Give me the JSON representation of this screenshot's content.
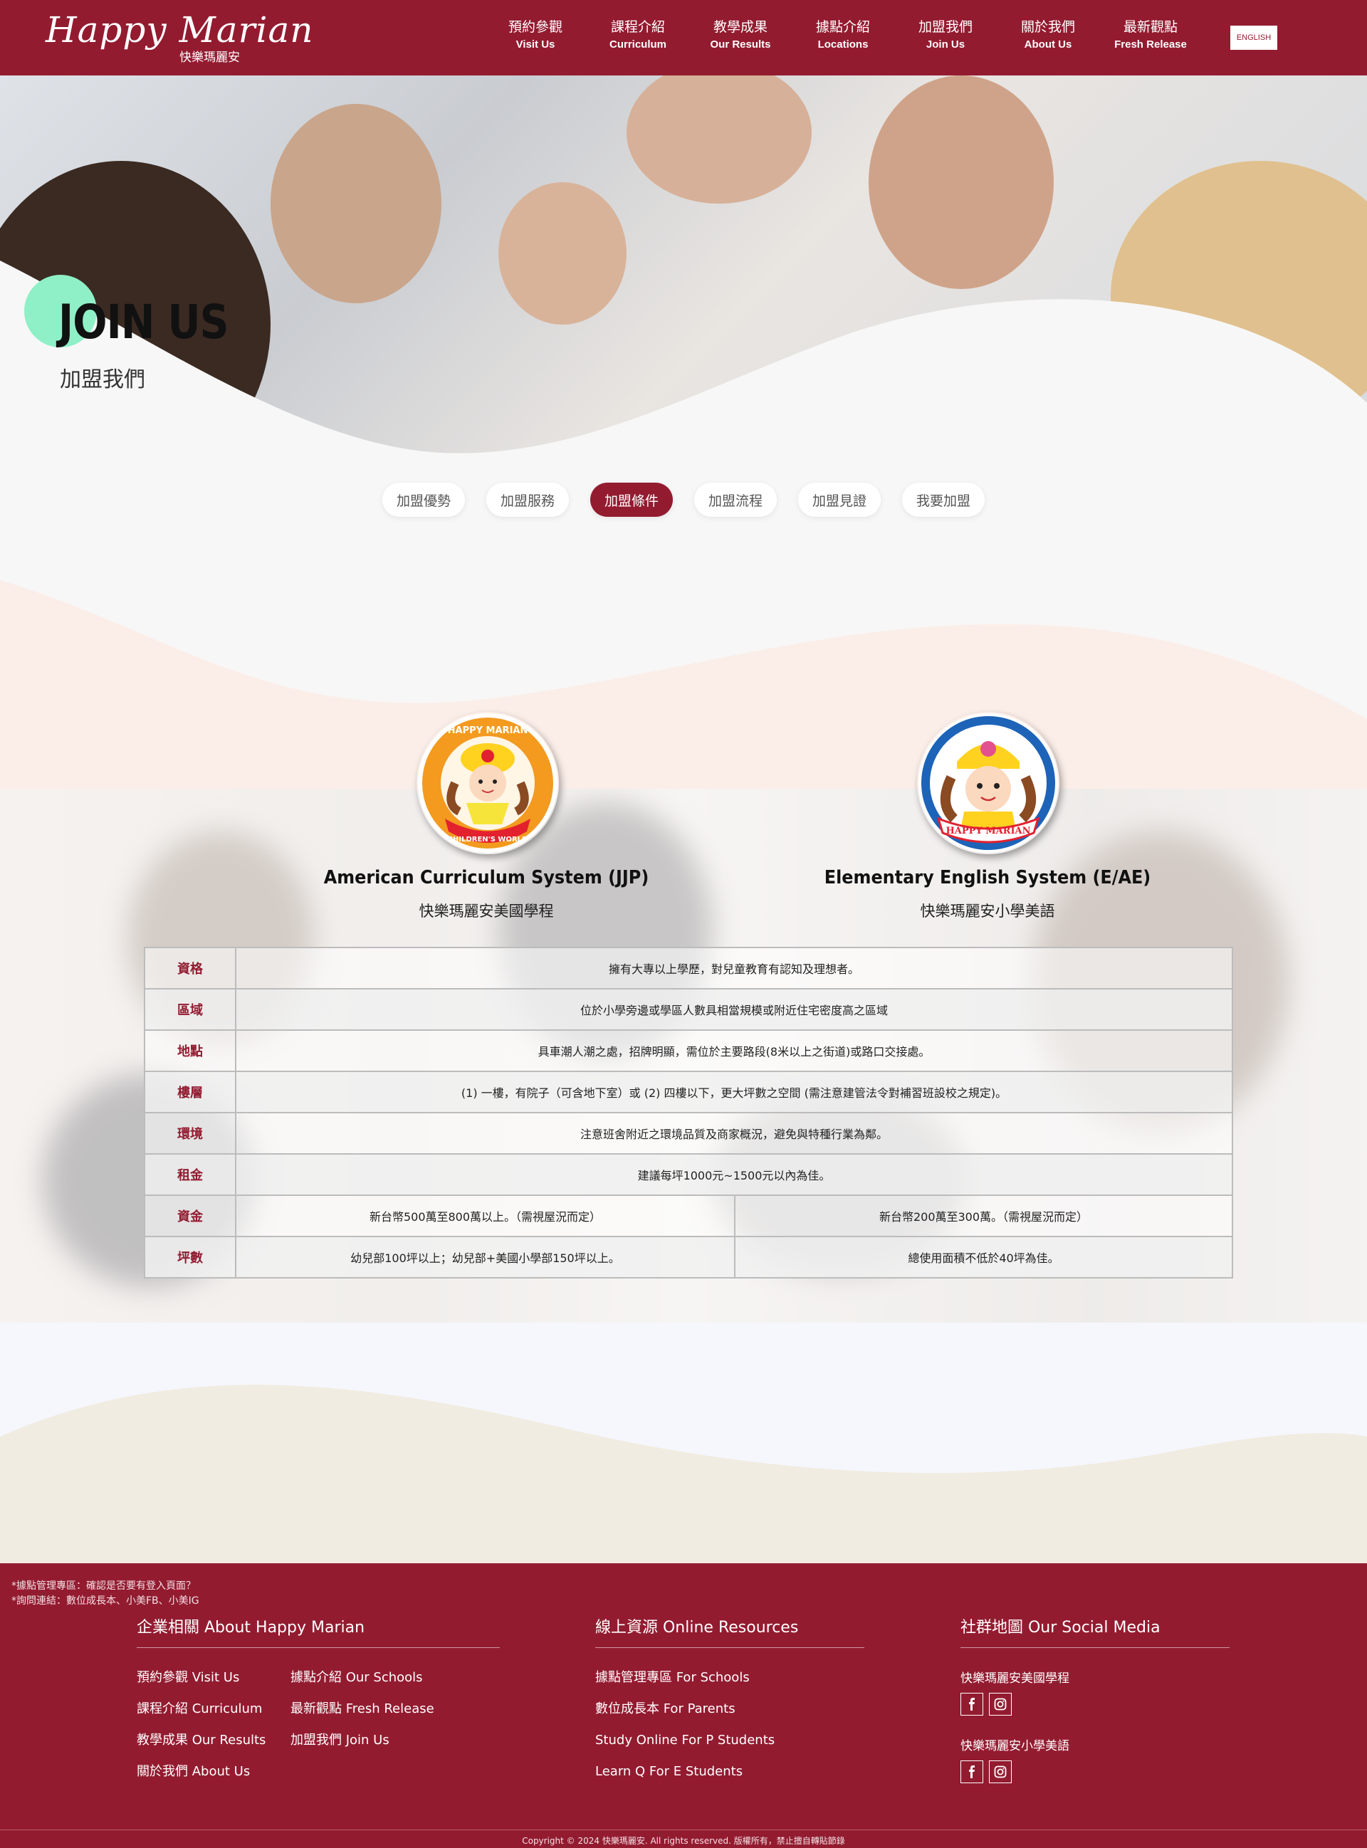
{
  "header": {
    "logo_main": "Happy Marian",
    "logo_sub": "快樂瑪麗安",
    "nav": [
      {
        "zh": "預約參觀",
        "en": "Visit Us"
      },
      {
        "zh": "課程介紹",
        "en": "Curriculum"
      },
      {
        "zh": "教學成果",
        "en": "Our Results"
      },
      {
        "zh": "據點介紹",
        "en": "Locations"
      },
      {
        "zh": "加盟我們",
        "en": "Join Us"
      },
      {
        "zh": "關於我們",
        "en": "About Us"
      },
      {
        "zh": "最新觀點",
        "en": "Fresh Release"
      }
    ],
    "lang_button": "ENGLISH"
  },
  "hero": {
    "title": "JOIN US",
    "subtitle": "加盟我們"
  },
  "tabs": [
    {
      "label": "加盟優勢",
      "active": false
    },
    {
      "label": "加盟服務",
      "active": false
    },
    {
      "label": "加盟條件",
      "active": true
    },
    {
      "label": "加盟流程",
      "active": false
    },
    {
      "label": "加盟見證",
      "active": false
    },
    {
      "label": "我要加盟",
      "active": false
    }
  ],
  "systems": [
    {
      "en": "American Curriculum System (JJP)",
      "zh": "快樂瑪麗安美國學程",
      "badge_top": "HAPPY MARIAN",
      "badge_bottom": "CHILDREN'S WORLD"
    },
    {
      "en": "Elementary English System (E/AE)",
      "zh": "快樂瑪麗安小學美語",
      "badge_ribbon": "HAPPY MARIAN"
    }
  ],
  "conditions": {
    "rows": [
      {
        "label": "資格",
        "value": "擁有大專以上學歷，對兒童教育有認知及理想者。"
      },
      {
        "label": "區域",
        "value": "位於小學旁邊或學區人數具相當規模或附近住宅密度高之區域"
      },
      {
        "label": "地點",
        "value": "具車潮人潮之處，招牌明顯，需位於主要路段(8米以上之街道)或路口交接處。"
      },
      {
        "label": "樓層",
        "value": "(1) 一樓，有院子（可含地下室）或 (2) 四樓以下，更大坪數之空間 (需注意建管法令對補習班設校之規定)。"
      },
      {
        "label": "環境",
        "value": "注意班舍附近之環境品質及商家概況，避免與特種行業為鄰。"
      },
      {
        "label": "租金",
        "value": "建議每坪1000元~1500元以內為佳。"
      }
    ],
    "split_rows": [
      {
        "label": "資金",
        "left": "新台幣500萬至800萬以上。（需視屋況而定）",
        "right": "新台幣200萬至300萬。（需視屋況而定）"
      },
      {
        "label": "坪數",
        "left": "幼兒部100坪以上；幼兒部+美國小學部150坪以上。",
        "right": "總使用面積不低於40坪為佳。"
      }
    ]
  },
  "footer": {
    "notes": [
      "*據點管理專區：確認是否要有登入頁面？",
      "*詢問連結：數位成長本、小美FB、小美IG"
    ],
    "about": {
      "title": "企業相關 About Happy Marian",
      "links": [
        "預約參觀  Visit Us",
        "據點介紹  Our Schools",
        "課程介紹  Curriculum",
        "最新觀點  Fresh Release",
        "教學成果  Our Results",
        "加盟我們  Join Us",
        "關於我們  About Us"
      ]
    },
    "online": {
      "title": "線上資源 Online Resources",
      "links": [
        "據點管理專區  For Schools",
        "數位成長本  For Parents",
        "Study Online  For P Students",
        "Learn Q  For E Students"
      ]
    },
    "social": {
      "title": "社群地圖 Our Social Media",
      "groups": [
        "快樂瑪麗安美國學程",
        "快樂瑪麗安小學美語"
      ]
    },
    "copyright": "Copyright © 2024 快樂瑪麗安. All rights reserved. 版權所有，禁止擅自轉貼節錄"
  },
  "colors": {
    "brand": "#931b30",
    "accent_circle": "#8ff0c7",
    "peach": "#fbeee8",
    "cream": "#f1ece1",
    "lavender": "#f6f7fd"
  },
  "icons": [
    "facebook-icon",
    "instagram-icon"
  ]
}
